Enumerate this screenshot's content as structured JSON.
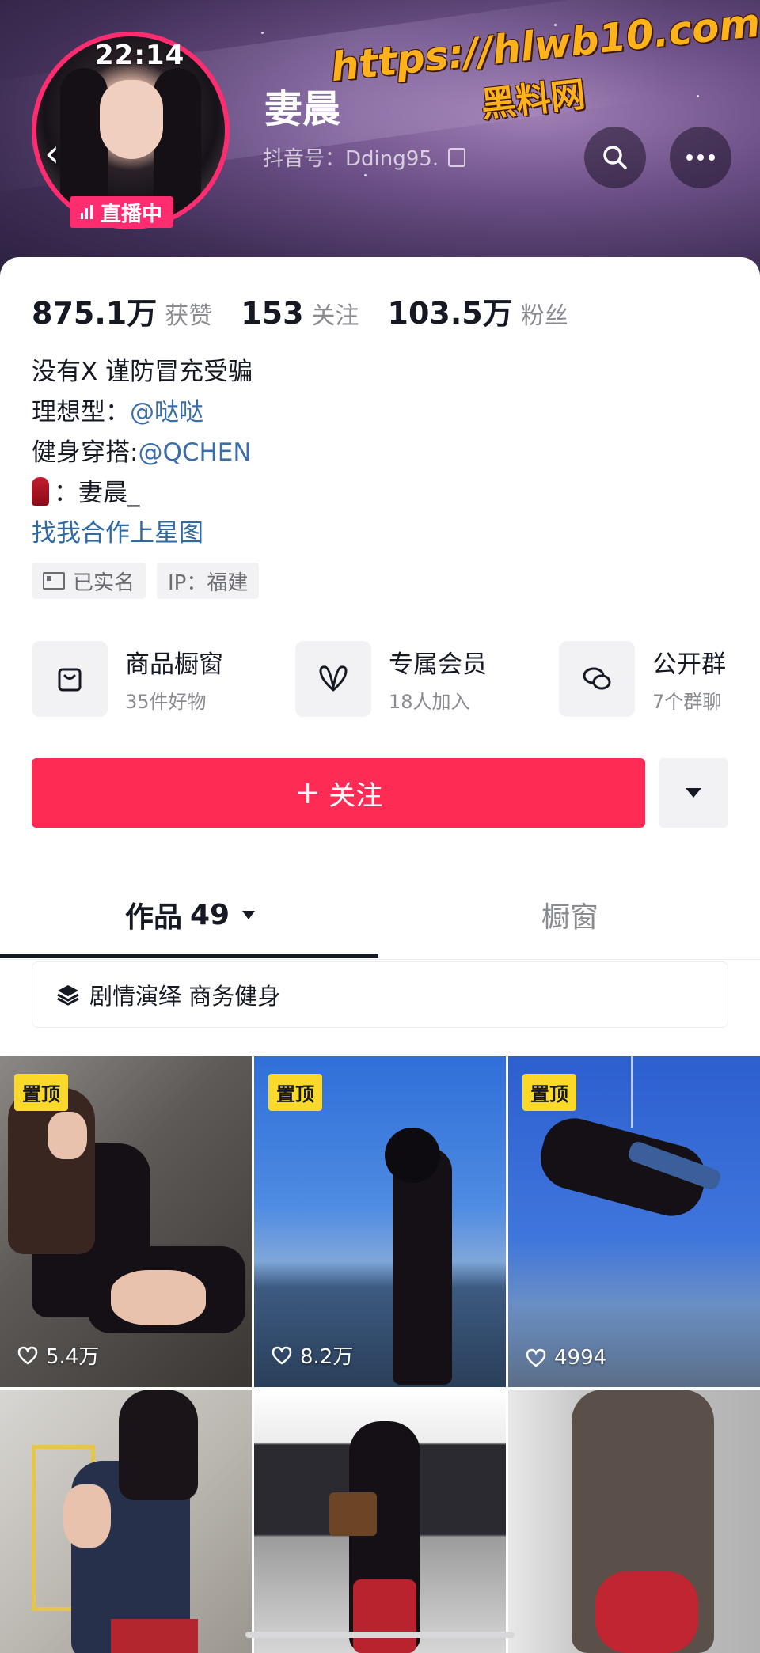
{
  "status": {
    "time": "22:14"
  },
  "header": {
    "name": "妻晨",
    "douyin_id": "抖音号：Dding95.",
    "live_badge": "直播中"
  },
  "watermark": {
    "url": "https://hlwb10.com",
    "site": "黑料网"
  },
  "stats": [
    {
      "value": "875.1万",
      "label": "获赞"
    },
    {
      "value": "153",
      "label": "关注"
    },
    {
      "value": "103.5万",
      "label": "粉丝"
    }
  ],
  "bio": {
    "line1": "没有X 谨防冒充受骗",
    "line2_prefix": "理想型：",
    "line2_mention": "@哒哒",
    "line3_prefix": "健身穿搭:",
    "line3_mention": "@QCHEN",
    "line4": "：妻晨_",
    "line5": "找我合作上星图"
  },
  "tags": {
    "verified": "已实名",
    "ip": "IP：福建"
  },
  "features": [
    {
      "title": "商品橱窗",
      "subtitle": "35件好物",
      "icon": "bag-icon"
    },
    {
      "title": "专属会员",
      "subtitle": "18人加入",
      "icon": "heart-v-icon"
    },
    {
      "title": "公开群",
      "subtitle": "7个群聊",
      "icon": "chat-icon"
    }
  ],
  "actions": {
    "follow": "关注"
  },
  "tabs": {
    "works_label": "作品",
    "works_count": "49",
    "shop_label": "橱窗"
  },
  "collection": {
    "label": "剧情演绎 商务健身"
  },
  "grid": [
    {
      "pinned": "置顶",
      "likes": "5.4万"
    },
    {
      "pinned": "置顶",
      "likes": "8.2万"
    },
    {
      "pinned": "置顶",
      "likes": "4994"
    },
    {},
    {},
    {}
  ],
  "colors": {
    "follow": "#fe2c55",
    "live": "#ff2d6f",
    "pin": "#fad92b",
    "link": "#3b6ea8"
  }
}
